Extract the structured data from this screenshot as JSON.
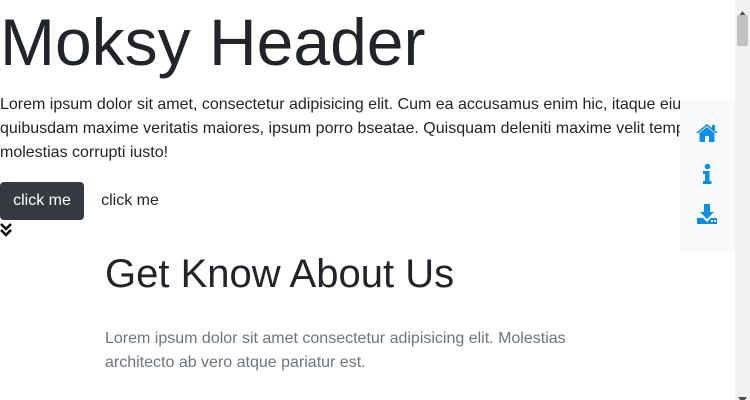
{
  "header": {
    "title": "Moksy Header"
  },
  "intro": {
    "lines": [
      "Lorem ipsum dolor sit amet, consectetur adipisicing elit. Cum ea accusamus enim hic, itaque eius",
      "quibusdam maxime veritatis maiores, ipsum porro bseatae. Quisquam deleniti maxime velit tempora",
      "molestias corrupti iusto!"
    ]
  },
  "buttons": {
    "primary_label": "click me",
    "secondary_label": "click me"
  },
  "about": {
    "heading": "Get Know About Us",
    "lines": [
      "Lorem ipsum dolor sit amet consectetur adipisicing elit. Molestias",
      "architecto ab vero atque pariatur est."
    ]
  },
  "side_nav": {
    "items": [
      {
        "icon": "home-icon"
      },
      {
        "icon": "info-icon"
      },
      {
        "icon": "download-icon"
      }
    ],
    "accent_color": "#0d8fe6"
  },
  "colors": {
    "dark_button": "#343a40",
    "muted_text": "#6c757d",
    "side_nav_bg": "#f8f9fa"
  }
}
